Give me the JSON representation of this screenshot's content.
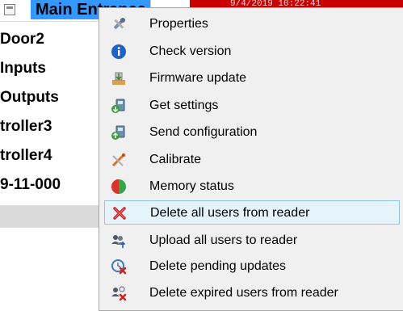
{
  "tree": {
    "selected_label": "Main Entrance",
    "items": [
      "Door2",
      "Inputs",
      "Outputs",
      "troller3",
      "troller4",
      "9-11-000"
    ]
  },
  "event_row": {
    "text": "9/4/2019 10:22:41"
  },
  "context_menu": {
    "highlighted_index": 7,
    "items": [
      {
        "label": "Properties",
        "icon": "tools-icon"
      },
      {
        "label": "Check version",
        "icon": "info-icon"
      },
      {
        "label": "Firmware update",
        "icon": "firmware-update-icon"
      },
      {
        "label": "Get settings",
        "icon": "get-settings-icon"
      },
      {
        "label": "Send configuration",
        "icon": "send-configuration-icon"
      },
      {
        "label": "Calibrate",
        "icon": "calibrate-icon"
      },
      {
        "label": "Memory status",
        "icon": "memory-status-icon"
      },
      {
        "label": "Delete all users from reader",
        "icon": "delete-red-x-icon"
      },
      {
        "label": "Upload all users to reader",
        "icon": "upload-users-icon"
      },
      {
        "label": "Delete pending updates",
        "icon": "delete-pending-updates-icon"
      },
      {
        "label": "Delete expired users from reader",
        "icon": "delete-expired-users-icon"
      }
    ]
  },
  "colors": {
    "selection_blue": "#3399ff",
    "event_red": "#c80000",
    "menu_bg": "#f0f0f0",
    "hover_bg": "#e5f3fb",
    "hover_border": "#8fc6ea"
  }
}
